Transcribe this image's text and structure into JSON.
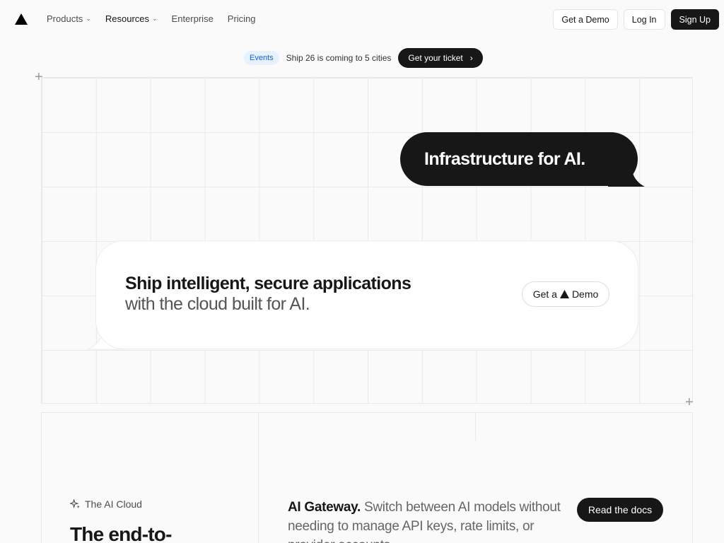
{
  "nav": {
    "logo_icon": "triangle-logo-icon",
    "links": [
      {
        "label": "Products",
        "has_menu": true
      },
      {
        "label": "Resources",
        "has_menu": true
      },
      {
        "label": "Enterprise",
        "has_menu": false
      },
      {
        "label": "Pricing",
        "has_menu": false
      }
    ],
    "demo_label": "Get a Demo",
    "login_label": "Log In",
    "signup_label": "Sign Up"
  },
  "announcement": {
    "badge": "Events",
    "text": "Ship 26 is coming to 5 cities",
    "cta": "Get your ticket",
    "cta_icon": "chevron-right-icon"
  },
  "hero": {
    "bubble": "Infrastructure for AI.",
    "title": "Ship intelligent, secure applications",
    "subtitle": "with the cloud built for AI.",
    "demo_before": "Get a",
    "demo_after": "Demo"
  },
  "section": {
    "label": "The AI Cloud",
    "label_icon": "sparkles-icon",
    "heading": "The end-to-",
    "gateway_title": "AI Gateway.",
    "gateway_text": "Switch between AI models without needing to manage API keys, rate limits, or provider accounts.",
    "docs_label": "Read the docs"
  },
  "colors": {
    "accent_dark": "#171717",
    "events_badge_bg": "#e8f1fe",
    "events_badge_text": "#0b63d6",
    "page_bg": "#fafafa"
  }
}
